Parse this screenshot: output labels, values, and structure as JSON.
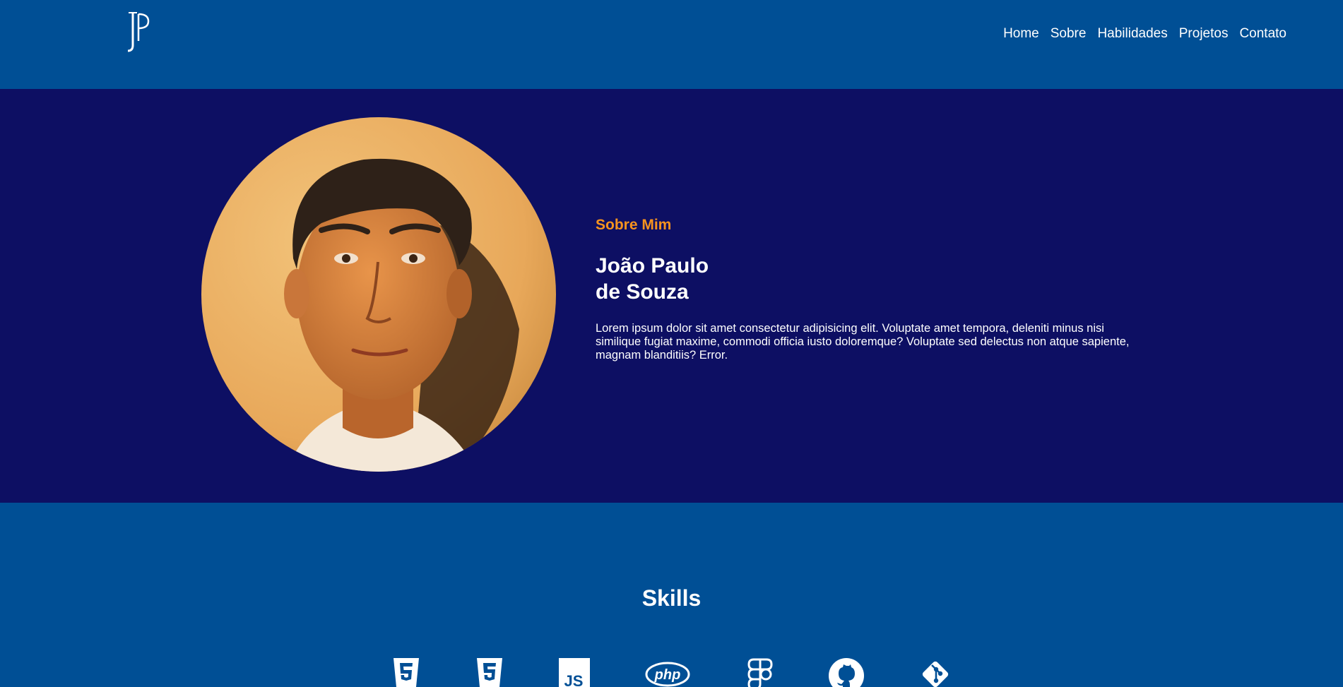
{
  "header": {
    "logo_icon": "jp-monogram-logo",
    "nav": [
      {
        "label": "Home"
      },
      {
        "label": "Sobre"
      },
      {
        "label": "Habilidades"
      },
      {
        "label": "Projetos"
      },
      {
        "label": "Contato"
      }
    ]
  },
  "about": {
    "label": "Sobre Mim",
    "name_line1": "João Paulo",
    "name_line2": "de Souza",
    "description": "Lorem ipsum dolor sit amet consectetur adipisicing elit. Voluptate amet tempora, deleniti minus nisi similique fugiat maxime, commodi officia iusto doloremque? Voluptate sed delectus non atque sapiente, magnam blanditiis? Error.",
    "photo_icon": "profile-photo"
  },
  "skills": {
    "title": "Skills",
    "icons": [
      "html5-icon",
      "css3-icon",
      "javascript-icon",
      "php-icon",
      "figma-icon",
      "github-icon",
      "git-icon"
    ],
    "php_text": "php",
    "js_text": "JS"
  },
  "colors": {
    "header_bg": "#004f95",
    "about_bg": "#0d0f63",
    "accent": "#f7931e",
    "text": "#ffffff"
  }
}
